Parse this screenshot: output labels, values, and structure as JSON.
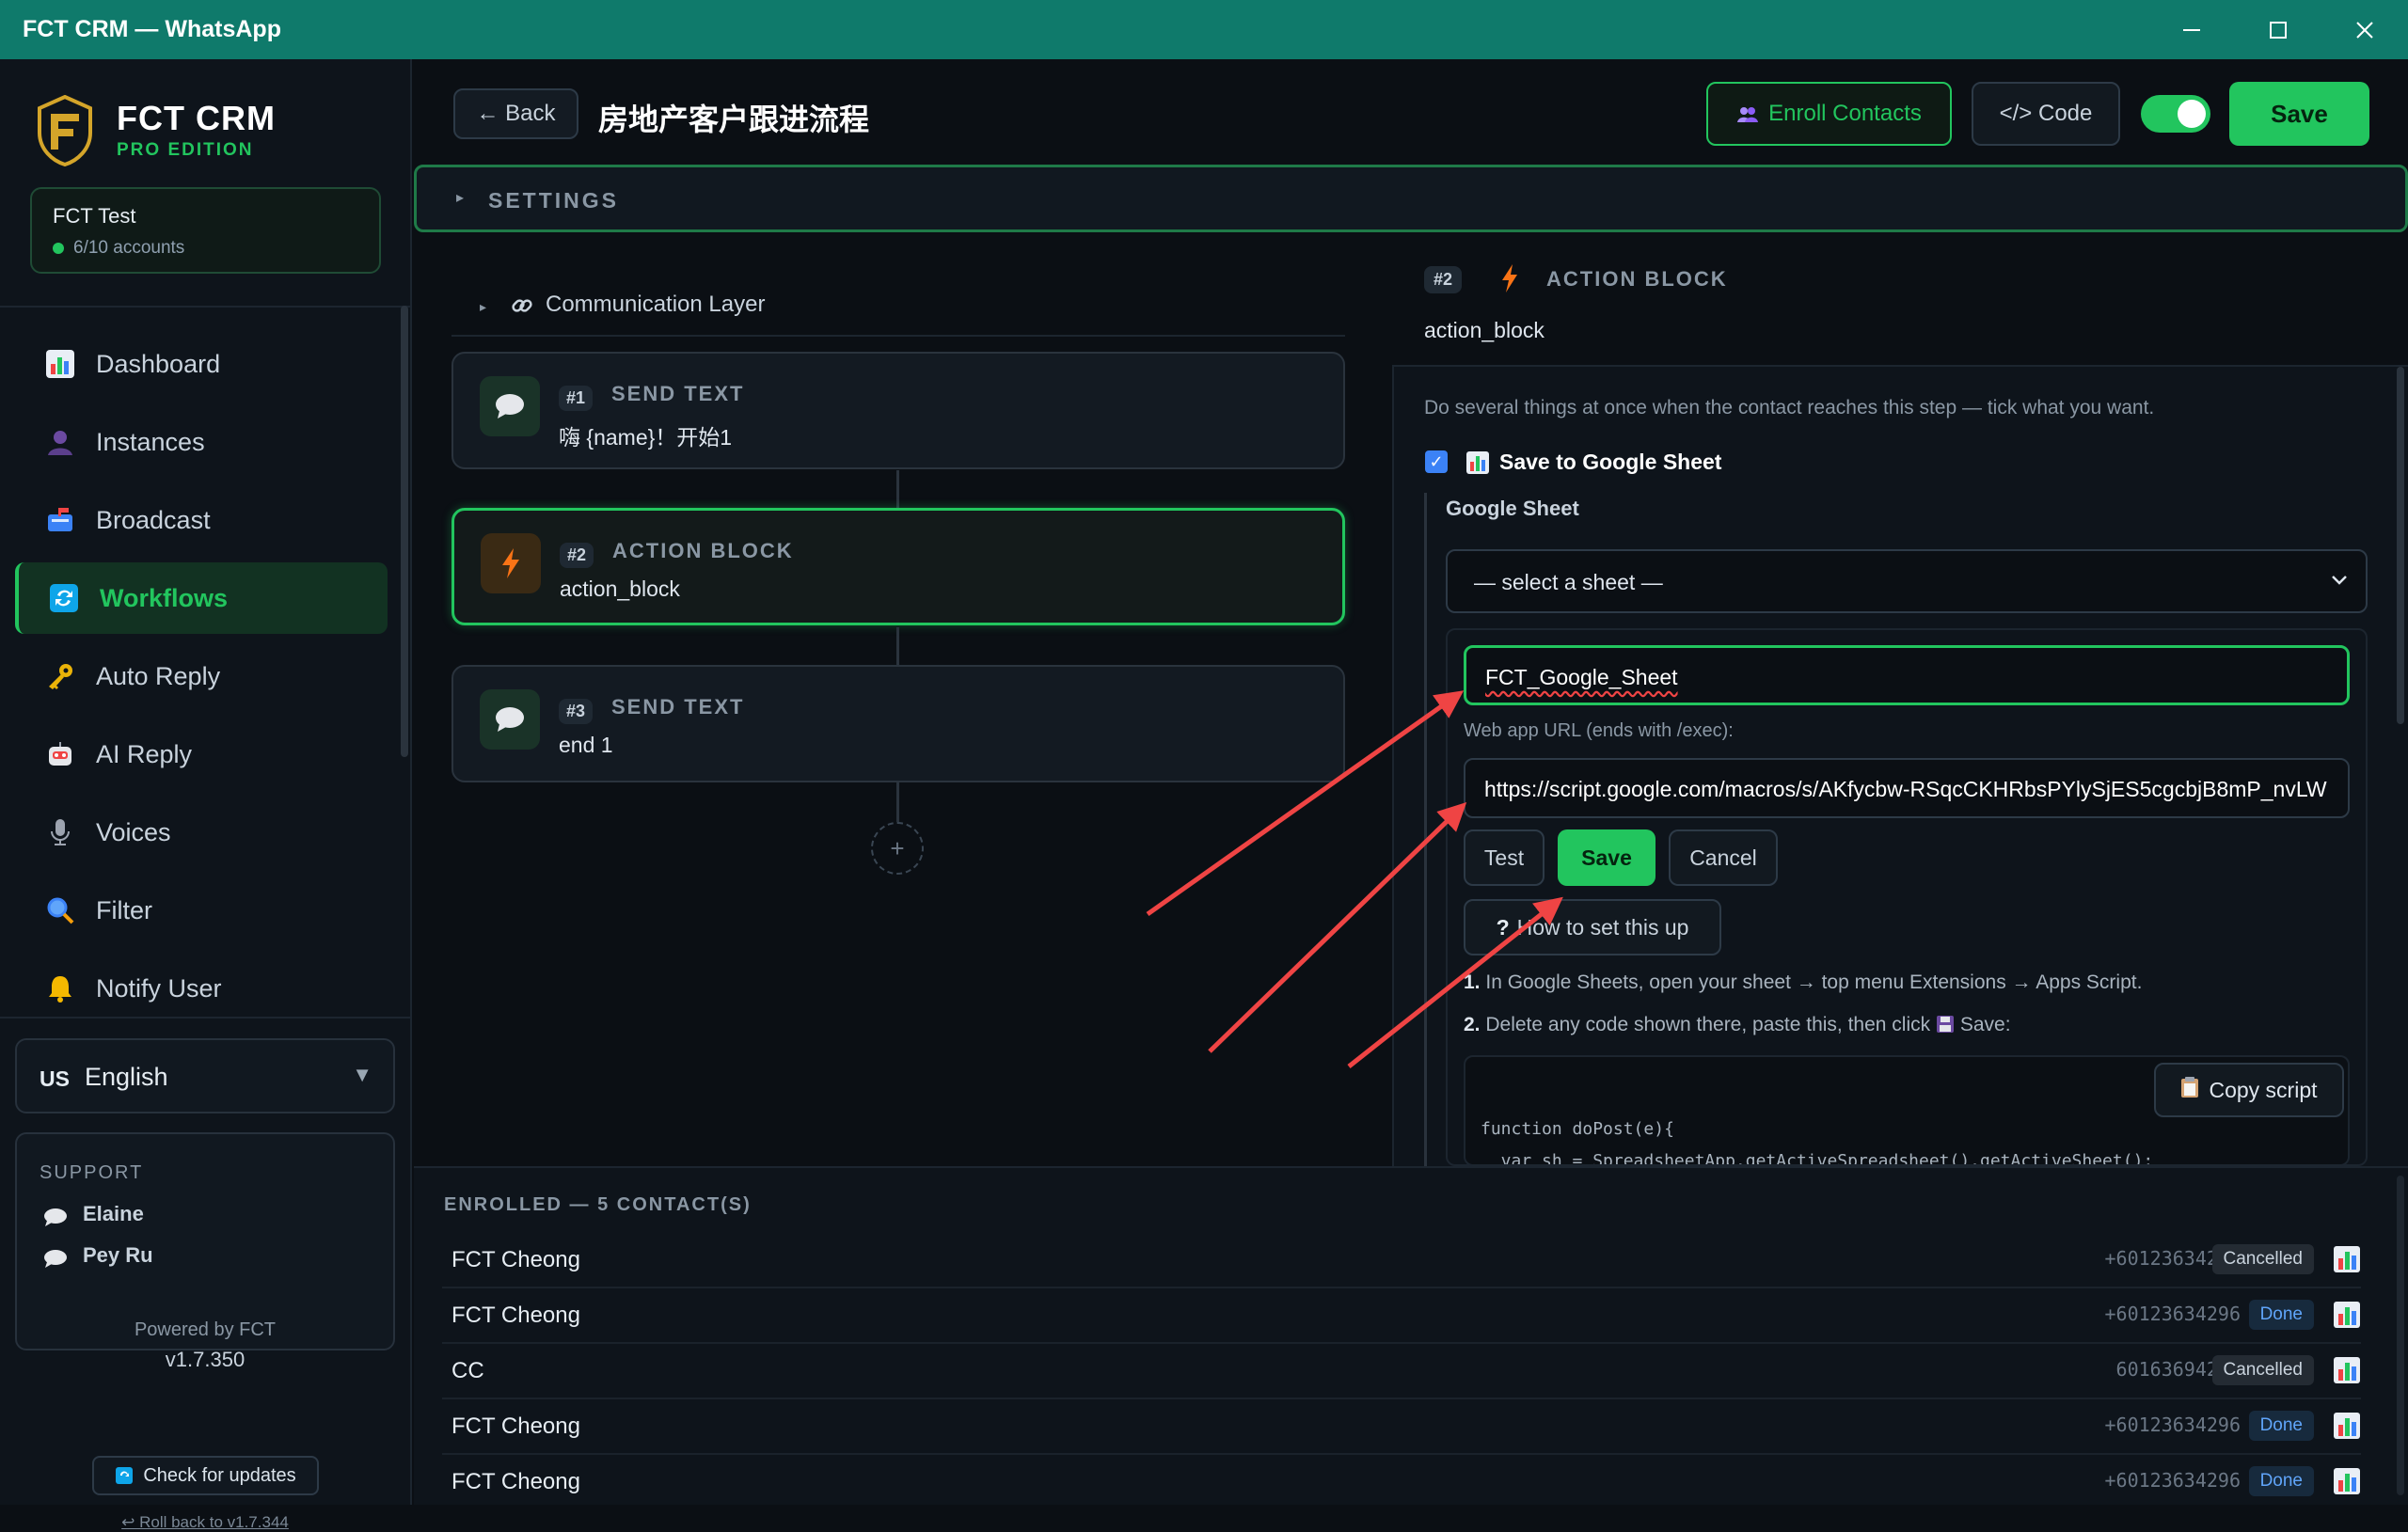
{
  "window": {
    "title": "FCT CRM — WhatsApp"
  },
  "brand": {
    "name": "FCT CRM",
    "edition": "PRO EDITION"
  },
  "account": {
    "name": "FCT Test",
    "status": "6/10 accounts"
  },
  "nav": [
    {
      "label": "Dashboard",
      "icon": "dashboard-icon"
    },
    {
      "label": "Instances",
      "icon": "instances-icon"
    },
    {
      "label": "Broadcast",
      "icon": "broadcast-icon"
    },
    {
      "label": "Workflows",
      "icon": "workflows-icon",
      "active": true
    },
    {
      "label": "Auto Reply",
      "icon": "key-icon"
    },
    {
      "label": "AI Reply",
      "icon": "robot-icon"
    },
    {
      "label": "Voices",
      "icon": "microphone-icon"
    },
    {
      "label": "Filter",
      "icon": "magnifier-icon"
    },
    {
      "label": "Notify User",
      "icon": "bell-icon"
    }
  ],
  "language": {
    "flag": "US",
    "value": "English"
  },
  "support": {
    "heading": "SUPPORT",
    "people": [
      "Elaine",
      "Pey Ru"
    ]
  },
  "footer": {
    "powered": "Powered by FCT",
    "version": "v1.7.350",
    "update": "Check for updates",
    "rollback": "↩ Roll back to v1.7.344"
  },
  "toolbar": {
    "back": "← Back",
    "title": "房地产客户跟进流程",
    "enroll": "Enroll Contacts",
    "code": "</> Code",
    "save": "Save",
    "enabled": true
  },
  "settings": {
    "label": "SETTINGS"
  },
  "flow": {
    "layer": "Communication Layer",
    "steps": [
      {
        "num": "#1",
        "kind": "SEND TEXT",
        "text": "嗨 {name}！开始1"
      },
      {
        "num": "#2",
        "kind": "ACTION BLOCK",
        "text": "action_block"
      },
      {
        "num": "#3",
        "kind": "SEND TEXT",
        "text": "end 1"
      }
    ]
  },
  "panel": {
    "num": "#2",
    "kind": "ACTION BLOCK",
    "sub": "action_block",
    "desc": "Do several things at once when the contact reaches this step — tick what you want.",
    "check_label": "Save to Google Sheet",
    "sheet_label": "Google Sheet",
    "select_value": "— select a sheet —",
    "name_value": "FCT_Google_Sheet",
    "url_label": "Web app URL (ends with /exec):",
    "url_value": "https://script.google.com/macros/s/AKfycbw-RSqcCKHRbsPYlySjES5cgcbjB8mP_nvLW",
    "test": "Test",
    "save": "Save",
    "cancel": "Cancel",
    "how": "How to set this up",
    "step1_num": "1.",
    "step1": "In Google Sheets, open your sheet → top menu Extensions → Apps Script.",
    "step2_num": "2.",
    "step2_a": "Delete any code shown there, paste this, then click",
    "step2_b": "Save:",
    "copy": "Copy script",
    "code": "function doPost(e){\n  var sh = SpreadsheetApp.getActiveSpreadsheet().getActiveSheet();"
  },
  "enrolled": {
    "heading": "ENROLLED — 5 CONTACT(S)",
    "rows": [
      {
        "name": "FCT Cheong",
        "phone": "+60123634296",
        "status": "Cancelled"
      },
      {
        "name": "FCT Cheong",
        "phone": "+60123634296",
        "status": "Done"
      },
      {
        "name": "CC",
        "phone": "60163694296",
        "status": "Cancelled"
      },
      {
        "name": "FCT Cheong",
        "phone": "+60123634296",
        "status": "Done"
      },
      {
        "name": "FCT Cheong",
        "phone": "+60123634296",
        "status": "Done"
      }
    ]
  },
  "colors": {
    "accent": "#22c55e",
    "titlebar": "#0f7a6b",
    "arrow": "#ef4444"
  }
}
